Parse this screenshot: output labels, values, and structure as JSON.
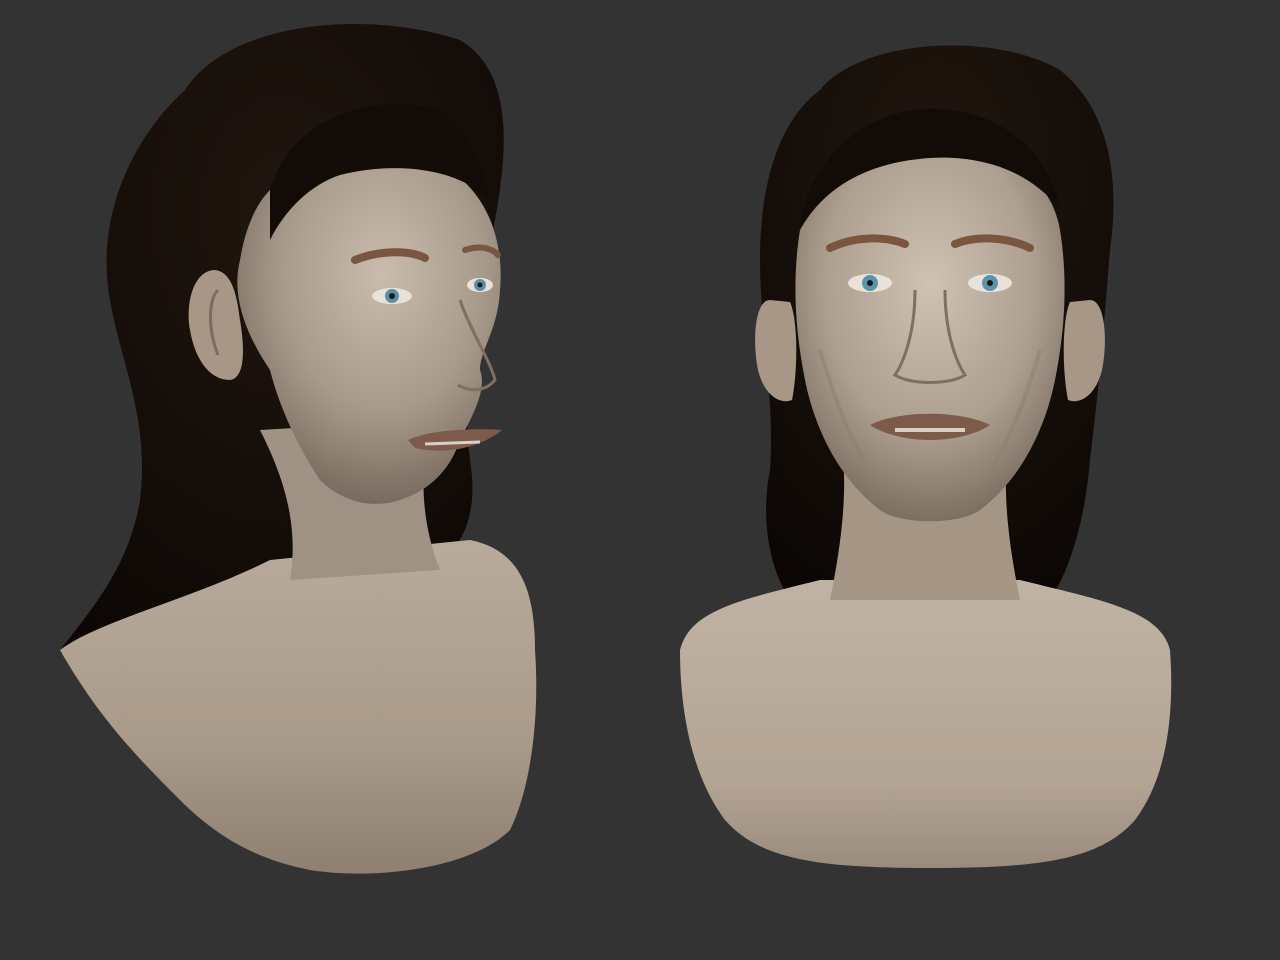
{
  "viewport": {
    "background": "#333334"
  },
  "renders": [
    {
      "id": "three-quarter",
      "skin": "#b3a596",
      "hair": "#120b08",
      "iris": "#5b8fa8",
      "brow": "#7a5540"
    },
    {
      "id": "front",
      "skin": "#b8ab9b",
      "hair": "#120b08",
      "iris": "#5b93ad",
      "brow": "#7a5540"
    }
  ]
}
